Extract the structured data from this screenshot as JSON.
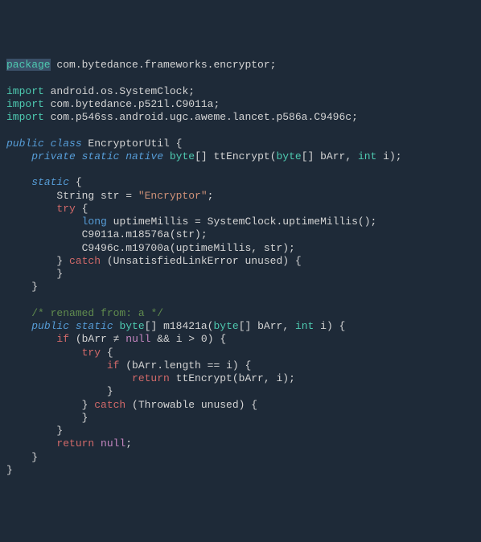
{
  "tokens": [
    [
      {
        "t": "package",
        "c": "kw-decl hl"
      },
      {
        "t": " com.bytedance.frameworks.encryptor;",
        "c": "ident"
      }
    ],
    [],
    [
      {
        "t": "import",
        "c": "kw-decl"
      },
      {
        "t": " android.os.SystemClock;",
        "c": "ident"
      }
    ],
    [
      {
        "t": "import",
        "c": "kw-decl"
      },
      {
        "t": " com.bytedance.p521l.C9011a;",
        "c": "ident"
      }
    ],
    [
      {
        "t": "import",
        "c": "kw-decl"
      },
      {
        "t": " com.p546ss.android.ugc.aweme.lancet.p586a.C9496c;",
        "c": "ident"
      }
    ],
    [],
    [
      {
        "t": "public class",
        "c": "kw-mod"
      },
      {
        "t": " EncryptorUtil ",
        "c": "ident"
      },
      {
        "t": "{",
        "c": "punct"
      }
    ],
    [
      {
        "t": "    ",
        "c": ""
      },
      {
        "t": "private static native",
        "c": "kw-mod"
      },
      {
        "t": " ",
        "c": ""
      },
      {
        "t": "byte",
        "c": "kw-type"
      },
      {
        "t": "[] ttEncrypt(",
        "c": "ident"
      },
      {
        "t": "byte",
        "c": "kw-type"
      },
      {
        "t": "[] bArr, ",
        "c": "ident"
      },
      {
        "t": "int",
        "c": "kw-type"
      },
      {
        "t": " i);",
        "c": "ident"
      }
    ],
    [],
    [
      {
        "t": "    ",
        "c": ""
      },
      {
        "t": "static",
        "c": "kw-mod"
      },
      {
        "t": " {",
        "c": "punct"
      }
    ],
    [
      {
        "t": "        String str = ",
        "c": "ident"
      },
      {
        "t": "\"Encryptor\"",
        "c": "str"
      },
      {
        "t": ";",
        "c": "punct"
      }
    ],
    [
      {
        "t": "        ",
        "c": ""
      },
      {
        "t": "try",
        "c": "kw-red"
      },
      {
        "t": " {",
        "c": "punct"
      }
    ],
    [
      {
        "t": "            ",
        "c": ""
      },
      {
        "t": "long",
        "c": "long"
      },
      {
        "t": " uptimeMillis = SystemClock.uptimeMillis();",
        "c": "ident"
      }
    ],
    [
      {
        "t": "            C9011a.m18576a(str);",
        "c": "ident"
      }
    ],
    [
      {
        "t": "            C9496c.m19700a(uptimeMillis, str);",
        "c": "ident"
      }
    ],
    [
      {
        "t": "        } ",
        "c": "punct"
      },
      {
        "t": "catch",
        "c": "kw-red"
      },
      {
        "t": " (UnsatisfiedLinkError unused) {",
        "c": "ident"
      }
    ],
    [
      {
        "t": "        }",
        "c": "punct"
      }
    ],
    [
      {
        "t": "    }",
        "c": "punct"
      }
    ],
    [],
    [
      {
        "t": "    ",
        "c": ""
      },
      {
        "t": "/* renamed from: a */",
        "c": "comment"
      }
    ],
    [
      {
        "t": "    ",
        "c": ""
      },
      {
        "t": "public static",
        "c": "kw-mod"
      },
      {
        "t": " ",
        "c": ""
      },
      {
        "t": "byte",
        "c": "kw-type"
      },
      {
        "t": "[] m18421a(",
        "c": "ident"
      },
      {
        "t": "byte",
        "c": "kw-type"
      },
      {
        "t": "[] bArr, ",
        "c": "ident"
      },
      {
        "t": "int",
        "c": "kw-type"
      },
      {
        "t": " i) {",
        "c": "ident"
      }
    ],
    [
      {
        "t": "        ",
        "c": ""
      },
      {
        "t": "if",
        "c": "kw-red"
      },
      {
        "t": " (bArr ",
        "c": "ident"
      },
      {
        "t": "≠",
        "c": "op"
      },
      {
        "t": " ",
        "c": ""
      },
      {
        "t": "null",
        "c": "kw-ctrl"
      },
      {
        "t": " ",
        "c": ""
      },
      {
        "t": "&&",
        "c": "op"
      },
      {
        "t": " i > ",
        "c": "ident"
      },
      {
        "t": "0",
        "c": "ident"
      },
      {
        "t": ") {",
        "c": "ident"
      }
    ],
    [
      {
        "t": "            ",
        "c": ""
      },
      {
        "t": "try",
        "c": "kw-red"
      },
      {
        "t": " {",
        "c": "punct"
      }
    ],
    [
      {
        "t": "                ",
        "c": ""
      },
      {
        "t": "if",
        "c": "kw-red"
      },
      {
        "t": " (bArr.length ",
        "c": "ident"
      },
      {
        "t": "==",
        "c": "op"
      },
      {
        "t": " i) {",
        "c": "ident"
      }
    ],
    [
      {
        "t": "                    ",
        "c": ""
      },
      {
        "t": "return",
        "c": "kw-red"
      },
      {
        "t": " ttEncrypt(bArr, i);",
        "c": "ident"
      }
    ],
    [
      {
        "t": "                }",
        "c": "punct"
      }
    ],
    [
      {
        "t": "            } ",
        "c": "punct"
      },
      {
        "t": "catch",
        "c": "kw-red"
      },
      {
        "t": " (Throwable unused) {",
        "c": "ident"
      }
    ],
    [
      {
        "t": "            }",
        "c": "punct"
      }
    ],
    [
      {
        "t": "        }",
        "c": "punct"
      }
    ],
    [
      {
        "t": "        ",
        "c": ""
      },
      {
        "t": "return",
        "c": "kw-red"
      },
      {
        "t": " ",
        "c": ""
      },
      {
        "t": "null",
        "c": "kw-ctrl"
      },
      {
        "t": ";",
        "c": "punct"
      }
    ],
    [
      {
        "t": "    }",
        "c": "punct"
      }
    ],
    [
      {
        "t": "}",
        "c": "punct"
      }
    ]
  ]
}
